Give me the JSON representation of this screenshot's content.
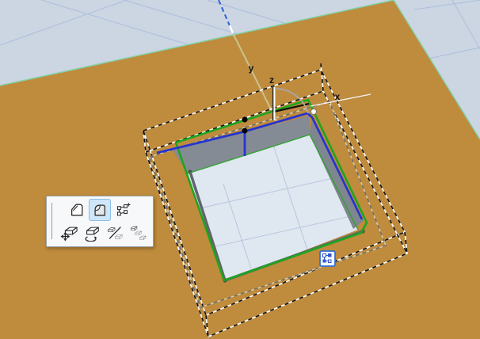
{
  "viewport": {
    "type": "3d-model-view",
    "axis_labels": {
      "x": "x",
      "y": "y",
      "z": "z"
    },
    "colors": {
      "terrain": "#bf8b3d",
      "sky": "#ccd5e2",
      "sky_grid": "#a9bfdd",
      "pit_floor": "#dfe7f0",
      "pit_wall": "#858b95",
      "selection_green": "#1ea51e",
      "edit_preview_blue": "#2635cf",
      "marching_ants_black": "#111111",
      "ghost_dash_gray": "#6d6d66"
    },
    "cursor_badge": {
      "icon": "move-sub-element-icon"
    }
  },
  "pet_palette": {
    "row1": [
      {
        "icon": "offset-edge-icon",
        "selected": false
      },
      {
        "icon": "offset-all-edges-icon",
        "selected": true
      },
      {
        "icon": "move-node-icon",
        "selected": false
      }
    ],
    "row2": [
      {
        "icon": "drag-icon",
        "selected": false
      },
      {
        "icon": "rotate-icon",
        "selected": false
      },
      {
        "icon": "mirror-icon",
        "selected": false
      },
      {
        "icon": "multiply-icon",
        "selected": false
      }
    ]
  }
}
